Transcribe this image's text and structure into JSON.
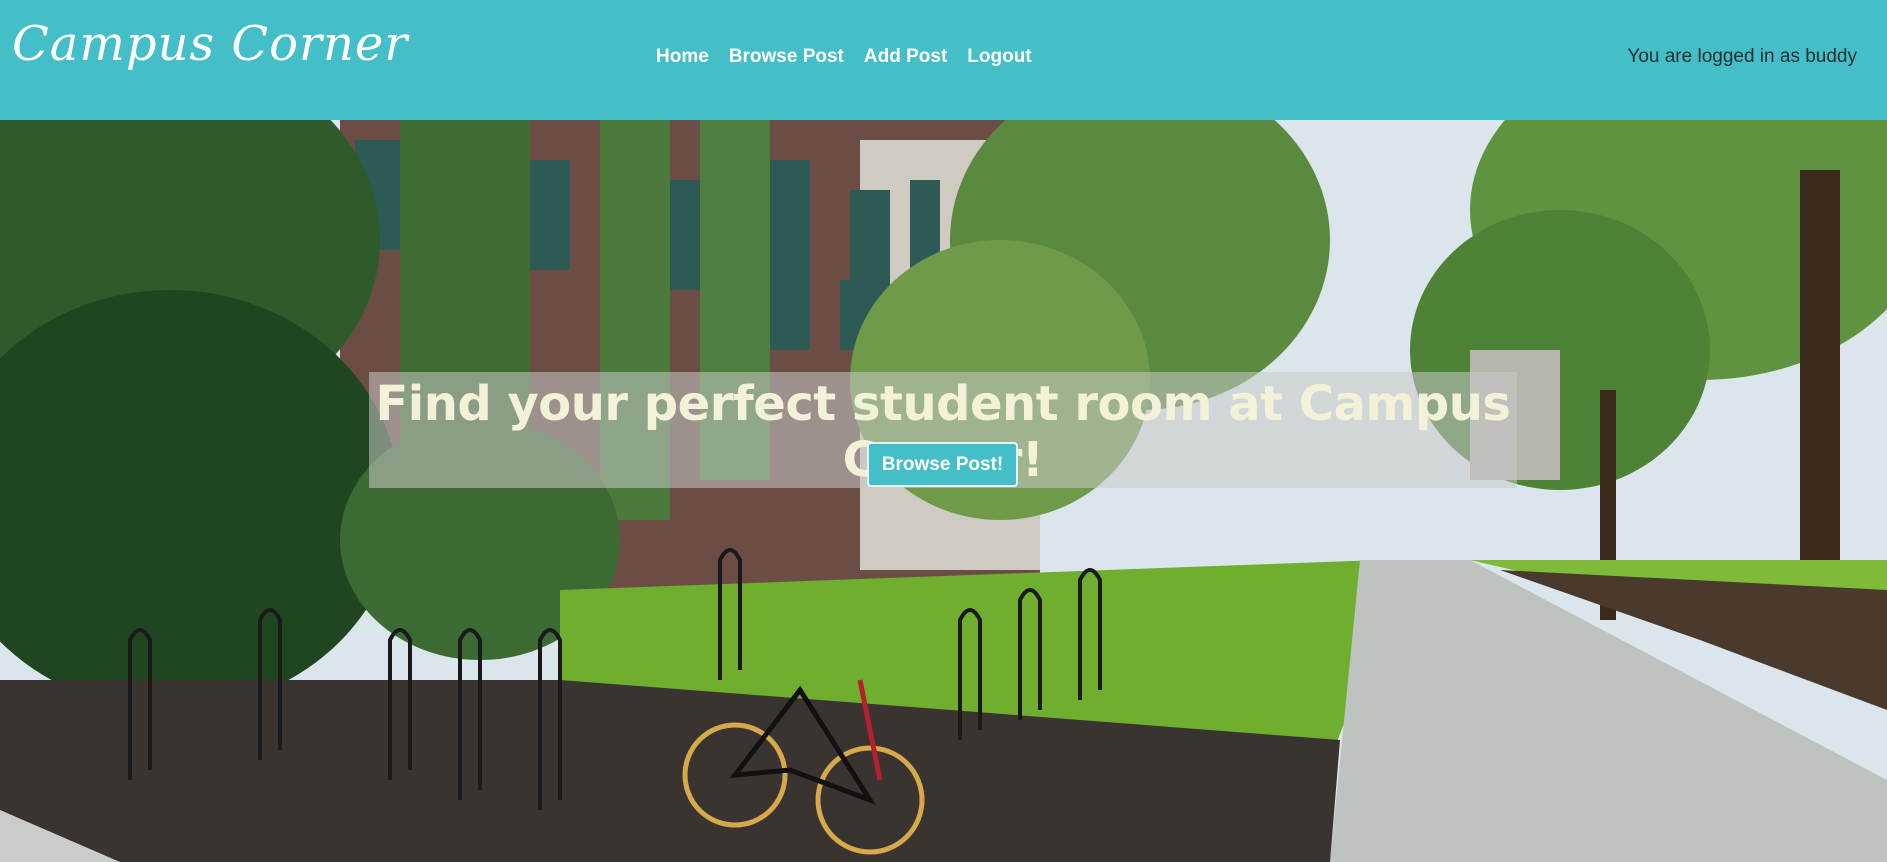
{
  "header": {
    "brand": "Campus Corner",
    "nav": {
      "home": "Home",
      "browse_post": "Browse Post",
      "add_post": "Add Post",
      "logout": "Logout"
    },
    "login_status": "You are logged in as buddy"
  },
  "hero": {
    "headline": "Find your perfect student room at Campus Corner!",
    "cta_label": "Browse Post!",
    "image": "campus-courtyard-photo"
  },
  "colors": {
    "brand": "#45bfc7",
    "headline_text": "#f3f1d8"
  }
}
